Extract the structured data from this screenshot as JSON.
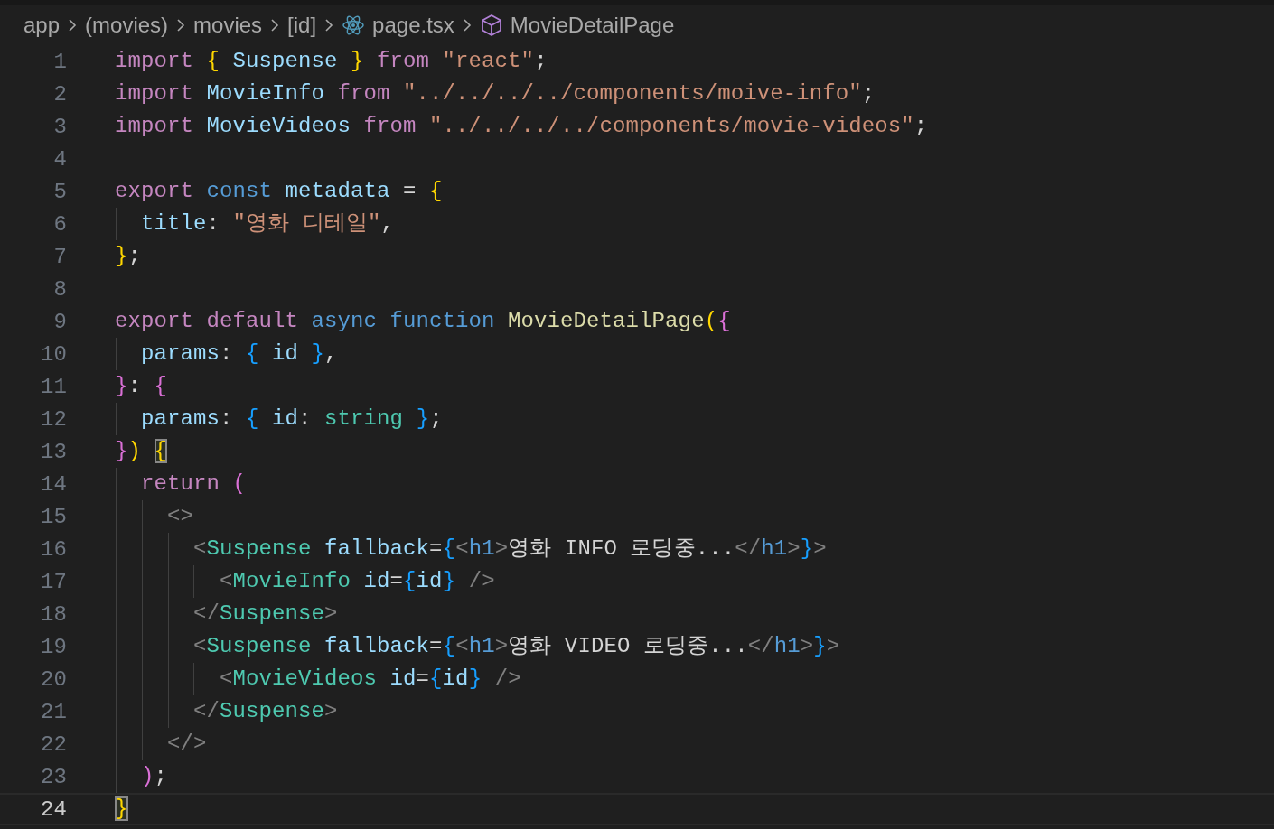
{
  "breadcrumbs": [
    {
      "kind": "folder",
      "label": "app"
    },
    {
      "kind": "folder",
      "label": "(movies)"
    },
    {
      "kind": "folder",
      "label": "movies"
    },
    {
      "kind": "folder",
      "label": "[id]"
    },
    {
      "kind": "file",
      "label": "page.tsx"
    },
    {
      "kind": "symbol",
      "label": "MovieDetailPage"
    }
  ],
  "lines": [
    {
      "number": "1",
      "current": false,
      "tokens": [
        {
          "kind": "kw",
          "text": "import "
        },
        {
          "kind": "b1",
          "text": "{"
        },
        {
          "kind": "var",
          "text": " Suspense "
        },
        {
          "kind": "b1",
          "text": "}"
        },
        {
          "kind": "kw",
          "text": " from "
        },
        {
          "kind": "str",
          "text": "\"react\""
        },
        {
          "kind": "text",
          "text": ";"
        }
      ]
    },
    {
      "number": "2",
      "current": false,
      "tokens": [
        {
          "kind": "kw",
          "text": "import "
        },
        {
          "kind": "var",
          "text": "MovieInfo "
        },
        {
          "kind": "kw",
          "text": "from "
        },
        {
          "kind": "str",
          "text": "\"../../../../components/moive-info\""
        },
        {
          "kind": "text",
          "text": ";"
        }
      ]
    },
    {
      "number": "3",
      "current": false,
      "tokens": [
        {
          "kind": "kw",
          "text": "import "
        },
        {
          "kind": "var",
          "text": "MovieVideos "
        },
        {
          "kind": "kw",
          "text": "from "
        },
        {
          "kind": "str",
          "text": "\"../../../../components/movie-videos\""
        },
        {
          "kind": "text",
          "text": ";"
        }
      ]
    },
    {
      "number": "4",
      "current": false
    },
    {
      "number": "5",
      "current": false,
      "tokens": [
        {
          "kind": "kw",
          "text": "export "
        },
        {
          "kind": "storage",
          "text": "const "
        },
        {
          "kind": "var",
          "text": "metadata "
        },
        {
          "kind": "text",
          "text": "= "
        },
        {
          "kind": "b1",
          "text": "{"
        }
      ]
    },
    {
      "number": "6",
      "current": false,
      "tokens": [
        {
          "kind": "var",
          "text": "  title"
        },
        {
          "kind": "text",
          "text": ": "
        },
        {
          "kind": "str",
          "text": "\"영화 디테일\""
        },
        {
          "kind": "text",
          "text": ","
        }
      ]
    },
    {
      "number": "7",
      "current": false,
      "tokens": [
        {
          "kind": "b1",
          "text": "}"
        },
        {
          "kind": "text",
          "text": ";"
        }
      ]
    },
    {
      "number": "8",
      "current": false
    },
    {
      "number": "9",
      "current": false,
      "tokens": [
        {
          "kind": "kw",
          "text": "export default "
        },
        {
          "kind": "storage",
          "text": "async function "
        },
        {
          "kind": "fn",
          "text": "MovieDetailPage"
        },
        {
          "kind": "b1",
          "text": "("
        },
        {
          "kind": "b2",
          "text": "{"
        }
      ]
    },
    {
      "number": "10",
      "current": false,
      "tokens": [
        {
          "kind": "var",
          "text": "  params"
        },
        {
          "kind": "text",
          "text": ": "
        },
        {
          "kind": "b3",
          "text": "{"
        },
        {
          "kind": "var",
          "text": " id "
        },
        {
          "kind": "b3",
          "text": "}"
        },
        {
          "kind": "text",
          "text": ","
        }
      ]
    },
    {
      "number": "11",
      "current": false,
      "tokens": [
        {
          "kind": "b2",
          "text": "}"
        },
        {
          "kind": "text",
          "text": ": "
        },
        {
          "kind": "b2",
          "text": "{"
        }
      ]
    },
    {
      "number": "12",
      "current": false,
      "tokens": [
        {
          "kind": "var",
          "text": "  params"
        },
        {
          "kind": "text",
          "text": ": "
        },
        {
          "kind": "b3",
          "text": "{"
        },
        {
          "kind": "var",
          "text": " id"
        },
        {
          "kind": "text",
          "text": ": "
        },
        {
          "kind": "type",
          "text": "string "
        },
        {
          "kind": "b3",
          "text": "}"
        },
        {
          "kind": "text",
          "text": ";"
        }
      ]
    },
    {
      "number": "13",
      "current": false,
      "tokens": [
        {
          "kind": "b2",
          "text": "}"
        },
        {
          "kind": "b1",
          "text": ") "
        },
        {
          "kind": "b1",
          "text": "{",
          "match": true
        }
      ]
    },
    {
      "number": "14",
      "current": false,
      "tokens": [
        {
          "kind": "kw",
          "text": "  return "
        },
        {
          "kind": "b2",
          "text": "("
        }
      ]
    },
    {
      "number": "15",
      "current": false,
      "tokens": [
        {
          "kind": "punct",
          "text": "    <>"
        }
      ]
    },
    {
      "number": "16",
      "current": false,
      "tokens": [
        {
          "kind": "punct",
          "text": "      <"
        },
        {
          "kind": "tag",
          "text": "Suspense"
        },
        {
          "kind": "var",
          "text": " fallback"
        },
        {
          "kind": "text",
          "text": "="
        },
        {
          "kind": "b3",
          "text": "{"
        },
        {
          "kind": "punct",
          "text": "<"
        },
        {
          "kind": "html",
          "text": "h1"
        },
        {
          "kind": "punct",
          "text": ">"
        },
        {
          "kind": "text",
          "text": "영화 INFO 로딩중..."
        },
        {
          "kind": "punct",
          "text": "</"
        },
        {
          "kind": "html",
          "text": "h1"
        },
        {
          "kind": "punct",
          "text": ">"
        },
        {
          "kind": "b3",
          "text": "}"
        },
        {
          "kind": "punct",
          "text": ">"
        }
      ]
    },
    {
      "number": "17",
      "current": false,
      "tokens": [
        {
          "kind": "punct",
          "text": "        <"
        },
        {
          "kind": "tag",
          "text": "MovieInfo"
        },
        {
          "kind": "var",
          "text": " id"
        },
        {
          "kind": "text",
          "text": "="
        },
        {
          "kind": "b3",
          "text": "{"
        },
        {
          "kind": "var",
          "text": "id"
        },
        {
          "kind": "b3",
          "text": "}"
        },
        {
          "kind": "punct",
          "text": " />"
        }
      ]
    },
    {
      "number": "18",
      "current": false,
      "tokens": [
        {
          "kind": "punct",
          "text": "      </"
        },
        {
          "kind": "tag",
          "text": "Suspense"
        },
        {
          "kind": "punct",
          "text": ">"
        }
      ]
    },
    {
      "number": "19",
      "current": false,
      "tokens": [
        {
          "kind": "punct",
          "text": "      <"
        },
        {
          "kind": "tag",
          "text": "Suspense"
        },
        {
          "kind": "var",
          "text": " fallback"
        },
        {
          "kind": "text",
          "text": "="
        },
        {
          "kind": "b3",
          "text": "{"
        },
        {
          "kind": "punct",
          "text": "<"
        },
        {
          "kind": "html",
          "text": "h1"
        },
        {
          "kind": "punct",
          "text": ">"
        },
        {
          "kind": "text",
          "text": "영화 VIDEO 로딩중..."
        },
        {
          "kind": "punct",
          "text": "</"
        },
        {
          "kind": "html",
          "text": "h1"
        },
        {
          "kind": "punct",
          "text": ">"
        },
        {
          "kind": "b3",
          "text": "}"
        },
        {
          "kind": "punct",
          "text": ">"
        }
      ]
    },
    {
      "number": "20",
      "current": false,
      "tokens": [
        {
          "kind": "punct",
          "text": "        <"
        },
        {
          "kind": "tag",
          "text": "MovieVideos"
        },
        {
          "kind": "var",
          "text": " id"
        },
        {
          "kind": "text",
          "text": "="
        },
        {
          "kind": "b3",
          "text": "{"
        },
        {
          "kind": "var",
          "text": "id"
        },
        {
          "kind": "b3",
          "text": "}"
        },
        {
          "kind": "punct",
          "text": " />"
        }
      ]
    },
    {
      "number": "21",
      "current": false,
      "tokens": [
        {
          "kind": "punct",
          "text": "      </"
        },
        {
          "kind": "tag",
          "text": "Suspense"
        },
        {
          "kind": "punct",
          "text": ">"
        }
      ]
    },
    {
      "number": "22",
      "current": false,
      "tokens": [
        {
          "kind": "punct",
          "text": "    </>"
        }
      ]
    },
    {
      "number": "23",
      "current": false,
      "tokens": [
        {
          "kind": "b2",
          "text": "  )"
        },
        {
          "kind": "text",
          "text": ";"
        }
      ]
    },
    {
      "number": "24",
      "current": true,
      "tokens": [
        {
          "kind": "b1",
          "text": "}",
          "match": true
        }
      ]
    }
  ]
}
